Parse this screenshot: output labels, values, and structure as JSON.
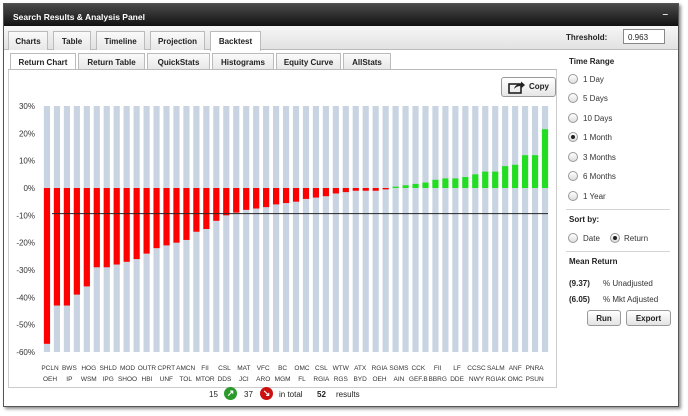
{
  "window": {
    "title": "Search Results & Analysis Panel",
    "minimize": "–"
  },
  "tabs": [
    {
      "label": "Charts"
    },
    {
      "label": "Table"
    },
    {
      "label": "Timeline"
    },
    {
      "label": "Projection"
    },
    {
      "label": "Backtest"
    }
  ],
  "threshold": {
    "label": "Threshold:",
    "value": "0.963"
  },
  "subtabs": [
    {
      "label": "Return Chart"
    },
    {
      "label": "Return Table"
    },
    {
      "label": "QuickStats"
    },
    {
      "label": "Histograms"
    },
    {
      "label": "Equity Curve"
    },
    {
      "label": "AllStats"
    }
  ],
  "copy_button": {
    "label": "Copy",
    "icon": "share-icon"
  },
  "time_range": {
    "heading": "Time Range",
    "options": [
      "1 Day",
      "5 Days",
      "10 Days",
      "1 Month",
      "3 Months",
      "6 Months",
      "1 Year"
    ],
    "selected": "1 Month"
  },
  "sort_by": {
    "heading": "Sort by:",
    "options": [
      "Date",
      "Return"
    ],
    "selected": "Return"
  },
  "mean_return": {
    "heading": "Mean Return",
    "unadjusted_value": "(9.37)",
    "unadjusted_label": "% Unadjusted",
    "mkt_value": "(6.05)",
    "mkt_label": "% Mkt Adjusted"
  },
  "buttons": {
    "run": "Run",
    "export": "Export"
  },
  "footer": {
    "winners": "15",
    "losers": "37",
    "in_total_label": "in total",
    "total": "52",
    "results_label": "results"
  },
  "colors": {
    "negative": "#ff0000",
    "positive": "#22dd22",
    "background_bar": "#c8d4e2",
    "mean_line": "#222222"
  },
  "chart_data": {
    "type": "bar",
    "title": "",
    "xlabel": "",
    "ylabel": "",
    "ylim": [
      -60,
      30
    ],
    "yticks": [
      "30%",
      "20%",
      "10%",
      "0%",
      "-10%",
      "-20%",
      "-30%",
      "-40%",
      "-50%",
      "-60%"
    ],
    "mean_line": -9.37,
    "top_labels": [
      "PCLN",
      "BWS",
      "HOG",
      "SHLD",
      "MOD",
      "OUTR",
      "CPRT",
      "AMCN",
      "FII",
      "CSL",
      "MAT",
      "VFC",
      "BC",
      "OMC",
      "CSL",
      "WTW",
      "ATX",
      "RGIA",
      "SGMS",
      "CCK",
      "FII",
      "LF",
      "CCSC",
      "SALM",
      "ANF",
      "PNRA"
    ],
    "bottom_labels": [
      "OEH",
      "IP",
      "WSM",
      "IPG",
      "SHOO",
      "HBI",
      "UNF",
      "TOL",
      "MTOR",
      "DDS",
      "JCI",
      "ARO",
      "MGM",
      "FL",
      "RGIA",
      "RGS",
      "BYD",
      "OEH",
      "AIN",
      "GEF.B",
      "BBRG",
      "DDE",
      "NWY",
      "RGIAK",
      "OMC",
      "PSUN"
    ],
    "values": [
      -57,
      -43,
      -43,
      -39,
      -36,
      -29,
      -29,
      -28,
      -27,
      -26,
      -24,
      -22,
      -21,
      -20,
      -19,
      -16,
      -15,
      -12,
      -10,
      -9,
      -8,
      -7.5,
      -7,
      -6,
      -5.5,
      -5,
      -4,
      -3.5,
      -3,
      -2,
      -1.5,
      -1,
      -1,
      -1,
      -0.5,
      0.5,
      1,
      1.5,
      2,
      3,
      3.5,
      3.5,
      4,
      5,
      6,
      6,
      8,
      8.5,
      12,
      12,
      21.5
    ]
  }
}
